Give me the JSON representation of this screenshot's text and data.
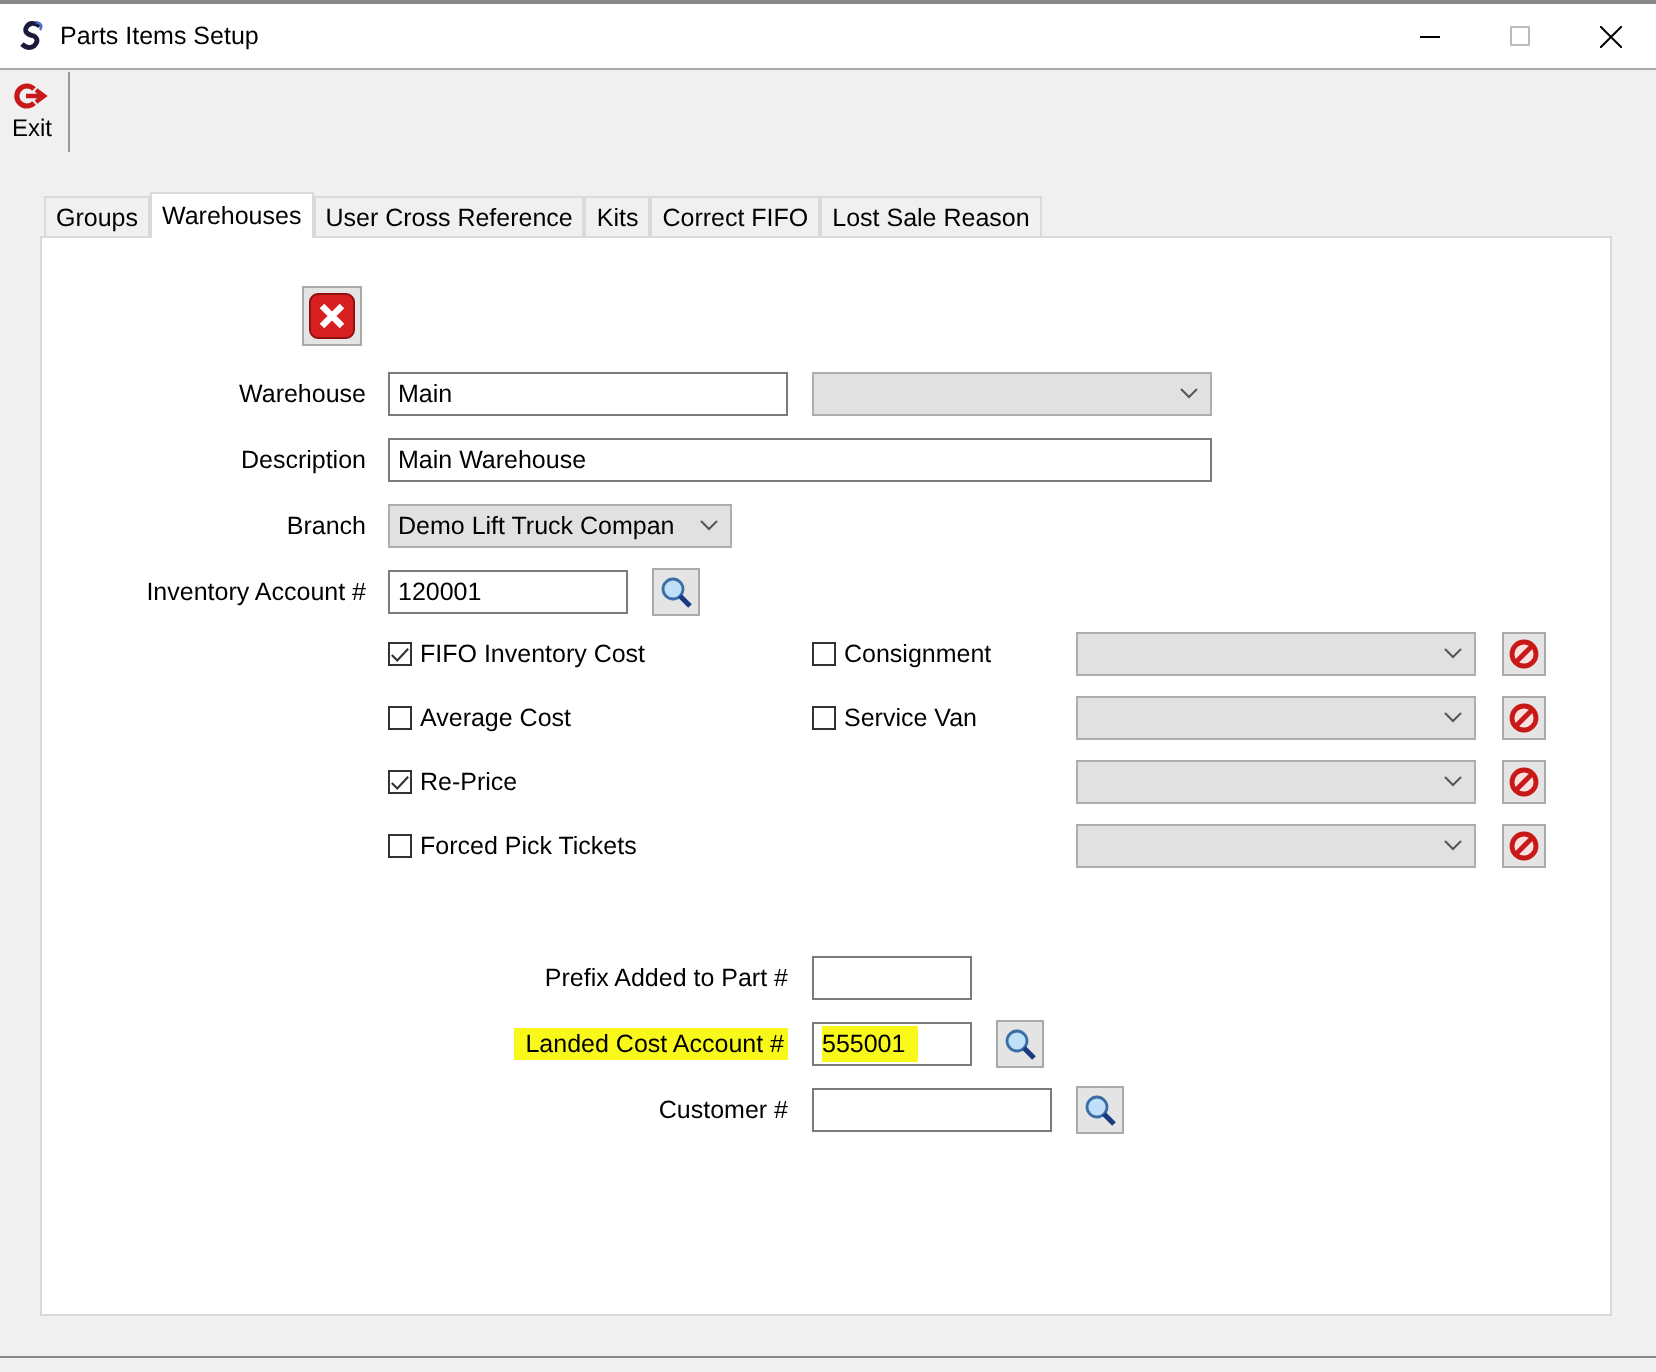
{
  "window": {
    "title": "Parts Items Setup"
  },
  "toolbar": {
    "buttons": [
      {
        "label": "Exit"
      }
    ]
  },
  "tabs": [
    {
      "label": "Groups",
      "selected": false
    },
    {
      "label": "Warehouses",
      "selected": true
    },
    {
      "label": "User Cross Reference",
      "selected": false
    },
    {
      "label": "Kits",
      "selected": false
    },
    {
      "label": "Correct FIFO",
      "selected": false
    },
    {
      "label": "Lost Sale Reason",
      "selected": false
    }
  ],
  "form": {
    "warehouse": {
      "label": "Warehouse",
      "value": "Main"
    },
    "description": {
      "label": "Description",
      "value": "Main Warehouse"
    },
    "branch": {
      "label": "Branch",
      "value": "Demo Lift Truck Compan"
    },
    "inventory_account": {
      "label": "Inventory Account #",
      "value": "120001"
    },
    "option_rows": [
      {
        "option": {
          "label": "FIFO Inventory Cost",
          "checked": true
        },
        "location_option": {
          "label": "Consignment",
          "checked": false
        }
      },
      {
        "option": {
          "label": "Average Cost",
          "checked": false
        },
        "location_option": {
          "label": "Service Van",
          "checked": false
        }
      },
      {
        "option": {
          "label": "Re-Price",
          "checked": true
        }
      },
      {
        "option": {
          "label": "Forced Pick Tickets",
          "checked": false
        }
      }
    ],
    "extra_fields": [
      {
        "label": "Prefix Added to Part #",
        "lookup": false,
        "highlighted": false,
        "wide": false
      },
      {
        "label": "Landed Cost Account #",
        "value": "555001",
        "lookup": true,
        "highlighted": true,
        "wide": false
      },
      {
        "label": "Customer #",
        "lookup": true,
        "highlighted": false,
        "wide": true
      }
    ]
  }
}
